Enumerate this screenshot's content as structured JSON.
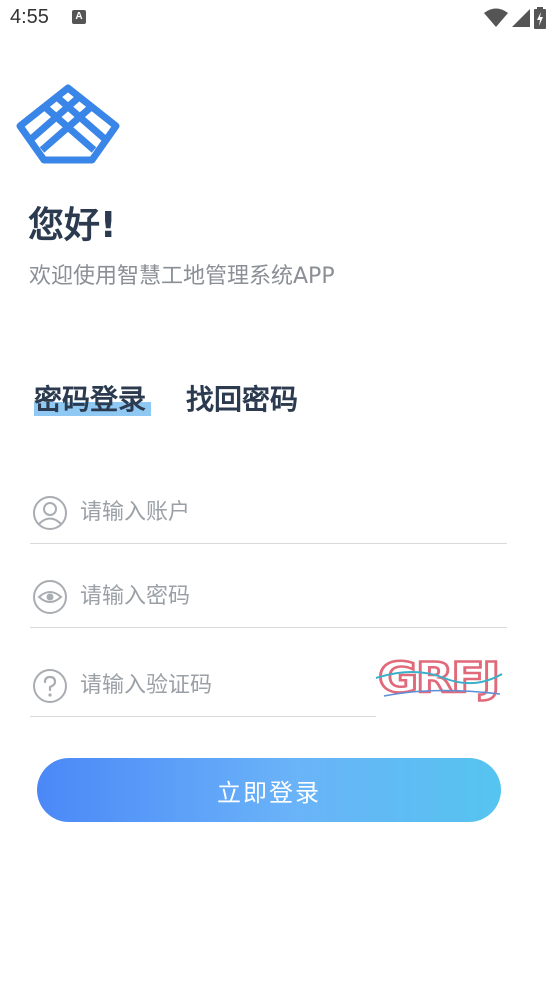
{
  "status_bar": {
    "time": "4:55",
    "notification_letter": "A"
  },
  "header": {
    "greeting": "您好!",
    "subtitle": "欢迎使用智慧工地管理系统APP"
  },
  "tabs": {
    "login": "密码登录",
    "forgot": "找回密码"
  },
  "form": {
    "account_placeholder": "请输入账户",
    "password_placeholder": "请输入密码",
    "code_placeholder": "请输入验证码",
    "captcha_text": "GRFJ"
  },
  "login_button": "立即登录",
  "colors": {
    "brand_blue": "#3a86e8",
    "tab_highlight": "#8ec8f3",
    "button_start": "#4b88f7",
    "button_end": "#55c4f0"
  }
}
